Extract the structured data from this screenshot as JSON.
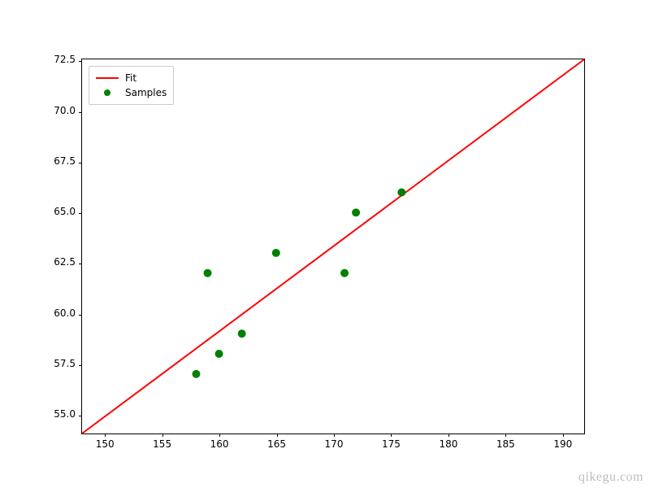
{
  "chart_data": {
    "type": "scatter",
    "series": [
      {
        "name": "Fit",
        "kind": "line",
        "color": "#ff0000",
        "x": [
          148,
          192
        ],
        "y": [
          54.05,
          72.59
        ]
      },
      {
        "name": "Samples",
        "kind": "scatter",
        "color": "#008000",
        "x": [
          158,
          159,
          160,
          162,
          165,
          171,
          172,
          176
        ],
        "y": [
          57.0,
          62.0,
          58.0,
          59.0,
          63.0,
          62.0,
          65.0,
          66.0
        ]
      }
    ],
    "xlabel": "",
    "ylabel": "",
    "title": "",
    "xlim": [
      148,
      192
    ],
    "ylim": [
      54.05,
      72.59
    ],
    "x_ticks": [
      150,
      155,
      160,
      165,
      170,
      175,
      180,
      185,
      190
    ],
    "y_ticks": [
      55.0,
      57.5,
      60.0,
      62.5,
      65.0,
      67.5,
      70.0,
      72.5
    ],
    "legend_position": "upper-left"
  },
  "legend": {
    "items": [
      {
        "label": "Fit"
      },
      {
        "label": "Samples"
      }
    ]
  },
  "watermark": "qikegu.com"
}
